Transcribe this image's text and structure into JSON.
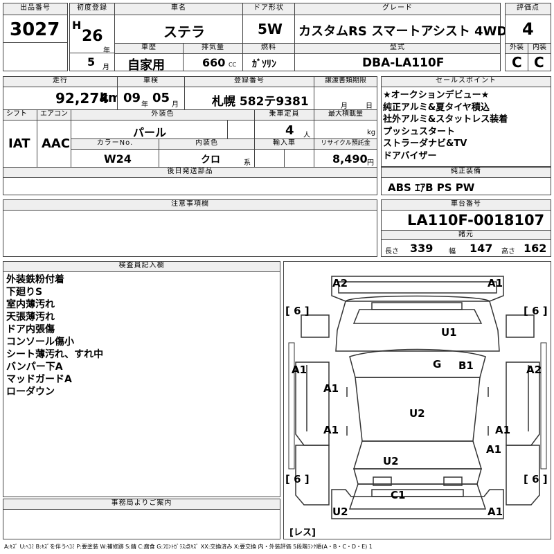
{
  "header": {
    "lot_label": "出品番号",
    "lot": "3027",
    "first_reg_label": "初度登録",
    "era": "H",
    "year": "26",
    "year_unit": "年",
    "month": "5",
    "month_unit": "月",
    "car_name_label": "車名",
    "car_name": "ステラ",
    "door_label": "ドア形状",
    "door": "5W",
    "grade_label": "グレード",
    "grade": "カスタムRS スマートアシスト 4WD",
    "score_label": "評価点",
    "score": "4",
    "exterior_label": "外装",
    "exterior": "C",
    "interior_label": "内装",
    "interior": "C",
    "history_label": "車歴",
    "history": "自家用",
    "displacement_label": "排気量",
    "displacement": "660",
    "displacement_unit": "CC",
    "fuel_label": "燃料",
    "fuel": "ｶﾞｿﾘﾝ",
    "model_label": "型式",
    "model": "DBA-LA110F"
  },
  "row2": {
    "mileage_label": "走行",
    "mileage": "92,274",
    "mileage_unit": "km",
    "inspection_label": "車検",
    "insp_year": "09",
    "insp_year_unit": "年",
    "insp_month": "05",
    "insp_month_unit": "月",
    "plate_label": "登録番号",
    "plate": "札幌 582テ9381",
    "transfer_label": "譲渡書類期限",
    "transfer_month": "月",
    "transfer_day": "日",
    "shift_label": "シフト",
    "shift": "IAT",
    "ac_label": "エアコン",
    "ac": "AAC",
    "color_label": "外装色",
    "color": "パール",
    "capacity_label": "乗車定員",
    "capacity": "4",
    "capacity_unit": "人",
    "load_label": "最大積載量",
    "load_unit": "kg",
    "color_no_label": "カラーNo.",
    "color_no": "W24",
    "int_color_label": "内装色",
    "int_color": "クロ",
    "int_color_unit": "系",
    "import_label": "輸入車",
    "recycle_label": "リサイクル預託金",
    "recycle": "8,490",
    "recycle_unit": "円"
  },
  "sales_points": {
    "label": "セールスポイント",
    "items": [
      "★オークションデビュー★",
      "純正アルミ&夏タイヤ積込",
      "社外アルミ&スタットレス装着",
      "プッシュスタート",
      "ストラーダナビ&TV",
      "ドアバイザー"
    ]
  },
  "later_parts": {
    "label": "後日発送部品"
  },
  "equipment": {
    "label": "純正装備",
    "value": "ABS ｴｱB PS PW"
  },
  "notes": {
    "label": "注意事項欄"
  },
  "chassis": {
    "label": "車台番号",
    "value": "LA110F-0018107"
  },
  "specs": {
    "label": "諸元",
    "length_label": "長さ",
    "length": "339",
    "width_label": "幅",
    "width": "147",
    "height_label": "高さ",
    "height": "162"
  },
  "inspector": {
    "label": "検査員記入欄",
    "items": [
      "外装鉄粉付着",
      "下廻りS",
      "室内薄汚れ",
      "天張薄汚れ",
      "ドア内張傷",
      "コンソール傷小",
      "シート薄汚れ、すれ中",
      "バンパー下A",
      "マッドガードA",
      "ローダウン"
    ]
  },
  "office": {
    "label": "事務局よりご案内"
  },
  "diagram": {
    "marks": [
      "A2",
      "A1",
      "A1",
      "A2",
      "U1",
      "G",
      "B1",
      "A1",
      "A1",
      "U2",
      "A1",
      "A1",
      "A1",
      "U2",
      "C1",
      "U2",
      "A1"
    ],
    "tire": "6",
    "bracket_l": "[",
    "bracket_r": "]",
    "res_label": "レス"
  },
  "legend": "A:ｷｽﾞ U:ﾍｺﾐ B:ｷｽﾞを伴うﾍｺﾐ P:要塗装 W:補修跡 S:錆 C:腐食 G:ﾌﾛﾝﾄｶﾞﾗｽ点ｷｽﾞ XX:交換済み X:要交換 内・外装評価 5段階ﾗﾝｸ順(A・B・C・D・E) 1"
}
